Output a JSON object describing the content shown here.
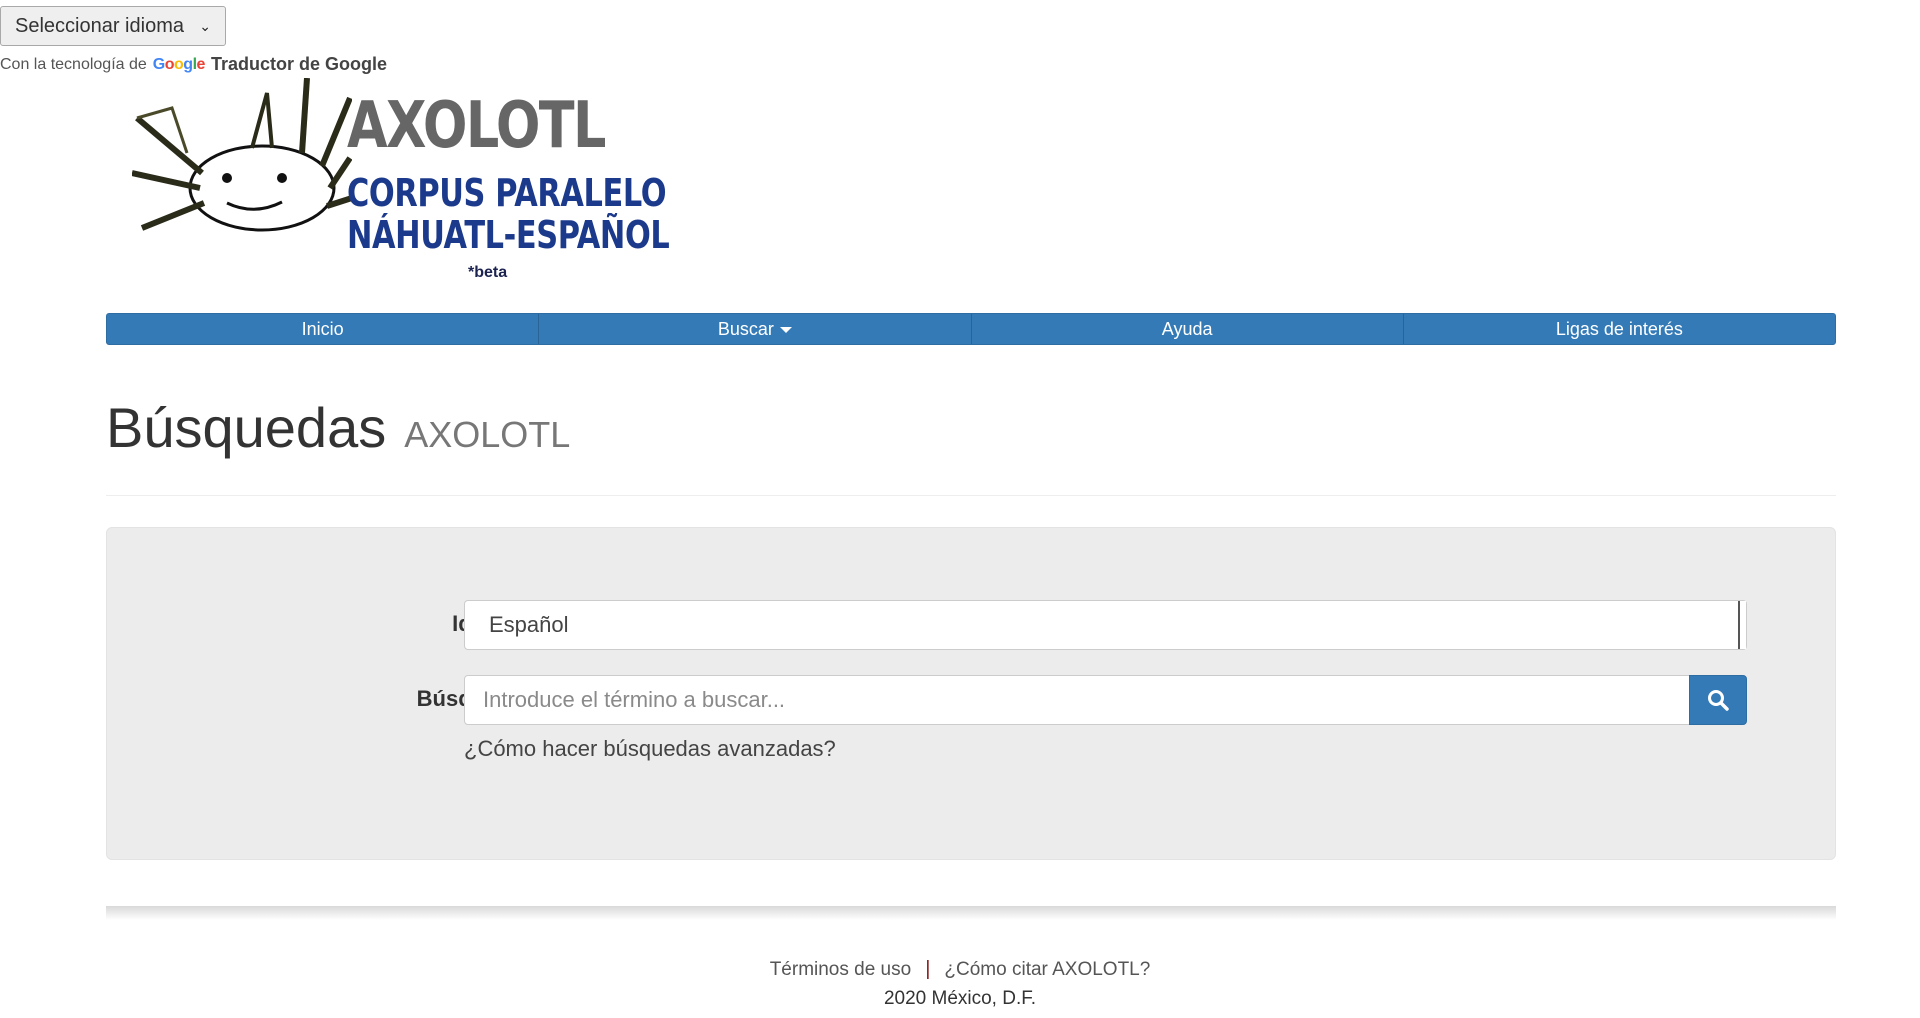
{
  "translate": {
    "select_label": "Seleccionar idioma",
    "powered_prefix": "Con la tecnología de",
    "google_word": "Google",
    "product": "Traductor de Google"
  },
  "logo": {
    "title": "AXOLOTL",
    "subtitle_line1": "CORPUS PARALELO",
    "subtitle_line2": "NÁHUATL-ESPAÑOL",
    "beta": "*beta"
  },
  "nav": {
    "items": [
      {
        "label": "Inicio"
      },
      {
        "label": "Buscar",
        "dropdown": true
      },
      {
        "label": "Ayuda"
      },
      {
        "label": "Ligas de interés"
      }
    ]
  },
  "header": {
    "title": "Búsquedas",
    "subtitle": "AXOLOTL"
  },
  "form": {
    "language_label": "Idioma",
    "language_value": "Español",
    "search_label": "Búsqueda",
    "search_placeholder": "Introduce el término a buscar...",
    "search_value": "",
    "advanced_help": "¿Cómo hacer búsquedas avanzadas?"
  },
  "footer": {
    "terms": "Términos de uso",
    "separator": "|",
    "cite": "¿Cómo citar AXOLOTL?",
    "copyright": "2020 México, D.F."
  },
  "colors": {
    "primary": "#337ab7",
    "logo_blue": "#1c3a8c",
    "well_bg": "#ececec"
  }
}
